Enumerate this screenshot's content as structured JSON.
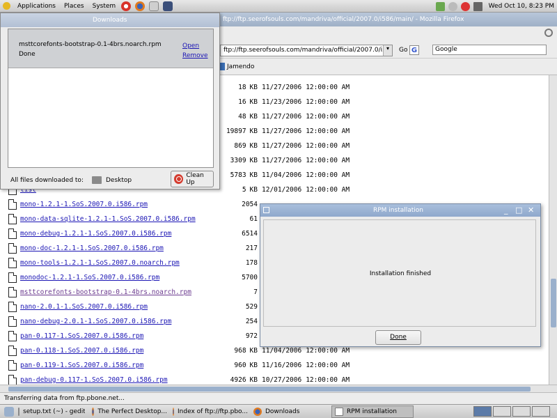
{
  "top_panel": {
    "menus": [
      "Applications",
      "Places",
      "System"
    ],
    "clock": "Wed Oct 10,  8:23 PM"
  },
  "firefox": {
    "title": "ftp://ftp.seerofsouls.com/mandriva/official/2007.0/i586/main/ - Mozilla Firefox",
    "url": "ftp://ftp.seerofsouls.com/mandriva/official/2007.0/i586/main/",
    "go_label": "Go",
    "search_value": "Google",
    "bookmark": "Jamendo",
    "status": "Transferring data from ftp.pbone.net..."
  },
  "listing": [
    {
      "name": "",
      "size": "18",
      "unit": "KB",
      "date": "11/27/2006",
      "time": "12:00:00 AM"
    },
    {
      "name": "",
      "size": "16",
      "unit": "KB",
      "date": "11/23/2006",
      "time": "12:00:00 AM"
    },
    {
      "name": "",
      "size": "48",
      "unit": "KB",
      "date": "11/27/2006",
      "time": "12:00:00 AM"
    },
    {
      "name": "",
      "size": "19897",
      "unit": "KB",
      "date": "11/27/2006",
      "time": "12:00:00 AM"
    },
    {
      "name": "",
      "size": "869",
      "unit": "KB",
      "date": "11/27/2006",
      "time": "12:00:00 AM"
    },
    {
      "name": "",
      "size": "3309",
      "unit": "KB",
      "date": "11/27/2006",
      "time": "12:00:00 AM"
    },
    {
      "name": "",
      "size": "5783",
      "unit": "KB",
      "date": "11/04/2006",
      "time": "12:00:00 AM"
    },
    {
      "name": "list",
      "size": "5",
      "unit": "KB",
      "date": "12/01/2006",
      "time": "12:00:00 AM"
    },
    {
      "name": "mono-1.2.1-1.SoS.2007.0.i586.rpm",
      "size": "2054",
      "unit": "",
      "date": "",
      "time": ""
    },
    {
      "name": "mono-data-sqlite-1.2.1-1.SoS.2007.0.i586.rpm",
      "size": "61",
      "unit": "",
      "date": "",
      "time": ""
    },
    {
      "name": "mono-debug-1.2.1-1.SoS.2007.0.i586.rpm",
      "size": "6514",
      "unit": "",
      "date": "",
      "time": ""
    },
    {
      "name": "mono-doc-1.2.1-1.SoS.2007.0.i586.rpm",
      "size": "217",
      "unit": "",
      "date": "",
      "time": ""
    },
    {
      "name": "mono-tools-1.2.1-1.SoS.2007.0.noarch.rpm",
      "size": "178",
      "unit": "",
      "date": "",
      "time": ""
    },
    {
      "name": "monodoc-1.2.1-1.SoS.2007.0.i586.rpm",
      "size": "5700",
      "unit": "",
      "date": "",
      "time": ""
    },
    {
      "name": "msttcorefonts-bootstrap-0.1-4brs.noarch.rpm",
      "size": "7",
      "unit": "",
      "date": "",
      "time": "",
      "visited": true
    },
    {
      "name": "nano-2.0.1-1.SoS.2007.0.i586.rpm",
      "size": "529",
      "unit": "",
      "date": "",
      "time": ""
    },
    {
      "name": "nano-debug-2.0.1-1.SoS.2007.0.i586.rpm",
      "size": "254",
      "unit": "",
      "date": "",
      "time": ""
    },
    {
      "name": "pan-0.117-1.SoS.2007.0.i586.rpm",
      "size": "972",
      "unit": "",
      "date": "",
      "time": ""
    },
    {
      "name": "pan-0.118-1.SoS.2007.0.i586.rpm",
      "size": "968",
      "unit": "KB",
      "date": "11/04/2006",
      "time": "12:00:00 AM"
    },
    {
      "name": "pan-0.119-1.SoS.2007.0.i586.rpm",
      "size": "960",
      "unit": "KB",
      "date": "11/16/2006",
      "time": "12:00:00 AM"
    },
    {
      "name": "pan-debug-0.117-1.SoS.2007.0.i586.rpm",
      "size": "4926",
      "unit": "KB",
      "date": "10/27/2006",
      "time": "12:00:00 AM"
    }
  ],
  "downloads": {
    "title": "Downloads",
    "item_name": "msttcorefonts-bootstrap-0.1-4brs.noarch.rpm",
    "item_status": "Done",
    "open_label": "Open",
    "remove_label": "Remove",
    "footer_label": "All files downloaded to:",
    "folder": "Desktop",
    "cleanup_label": "Clean Up"
  },
  "rpm_dialog": {
    "title": "RPM installation",
    "message": "Installation finished",
    "done_label": "Done"
  },
  "taskbar": [
    {
      "label": "setup.txt (~) - gedit",
      "active": false
    },
    {
      "label": "The Perfect Desktop...",
      "active": false
    },
    {
      "label": "Index of ftp://ftp.pbo...",
      "active": false
    },
    {
      "label": "Downloads",
      "active": false
    },
    {
      "label": "RPM installation",
      "active": true
    }
  ]
}
